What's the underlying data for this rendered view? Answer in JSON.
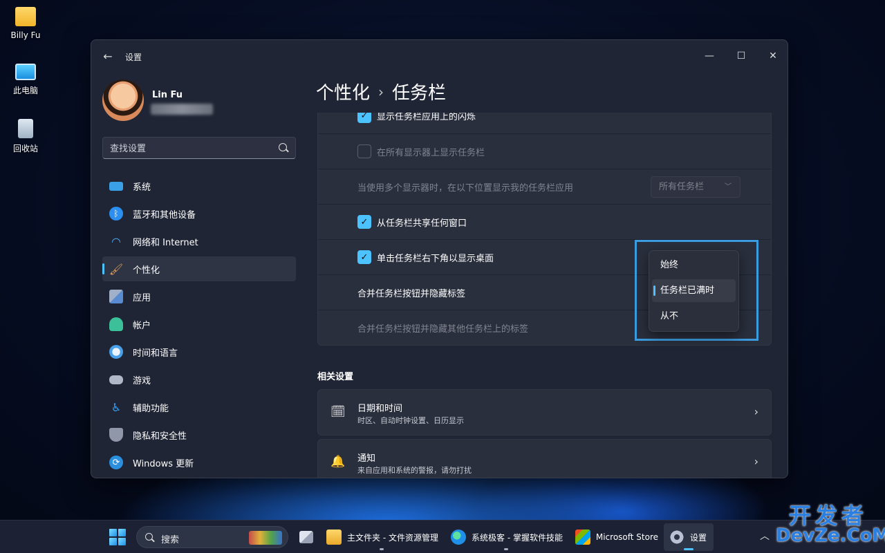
{
  "desktop": {
    "icons": [
      {
        "label": "Billy Fu",
        "icon": "folder-icon"
      },
      {
        "label": "此电脑",
        "icon": "this-pc-icon"
      },
      {
        "label": "回收站",
        "icon": "recycle-bin-icon"
      }
    ]
  },
  "window": {
    "title": "设置",
    "controls": {
      "minimize": "—",
      "maximize": "☐",
      "close": "✕"
    }
  },
  "profile": {
    "name": "Lin Fu"
  },
  "search": {
    "placeholder": "查找设置"
  },
  "sidebar": {
    "items": [
      {
        "label": "系统",
        "icon": "system-icon",
        "color": "#3aa0e8"
      },
      {
        "label": "蓝牙和其他设备",
        "icon": "bluetooth-icon",
        "color": "#2b8ff0"
      },
      {
        "label": "网络和 Internet",
        "icon": "wifi-icon",
        "color": "#4aa8f0"
      },
      {
        "label": "个性化",
        "icon": "brush-icon",
        "color": "#e0a060",
        "active": true
      },
      {
        "label": "应用",
        "icon": "apps-icon",
        "color": "#8fa0b8"
      },
      {
        "label": "帐户",
        "icon": "account-icon",
        "color": "#3cc09a"
      },
      {
        "label": "时间和语言",
        "icon": "time-language-icon",
        "color": "#4aa0e8"
      },
      {
        "label": "游戏",
        "icon": "gaming-icon",
        "color": "#b0b8c8"
      },
      {
        "label": "辅助功能",
        "icon": "accessibility-icon",
        "color": "#3aa0f0"
      },
      {
        "label": "隐私和安全性",
        "icon": "shield-icon",
        "color": "#8f97a8"
      },
      {
        "label": "Windows 更新",
        "icon": "update-icon",
        "color": "#2b8fe0"
      }
    ]
  },
  "breadcrumb": {
    "parent": "个性化",
    "separator": "›",
    "current": "任务栏"
  },
  "taskbar_behaviors": {
    "rows": [
      {
        "label": "显示任务栏应用上的闪烁",
        "type": "checkbox",
        "checked": true,
        "enabled": true
      },
      {
        "label": "在所有显示器上显示任务栏",
        "type": "checkbox",
        "checked": false,
        "enabled": false
      },
      {
        "label": "当使用多个显示器时，在以下位置显示我的任务栏应用",
        "type": "combo",
        "value": "所有任务栏",
        "enabled": false
      },
      {
        "label": "从任务栏共享任何窗口",
        "type": "checkbox",
        "checked": true,
        "enabled": true
      },
      {
        "label": "单击任务栏右下角以显示桌面",
        "type": "checkbox",
        "checked": true,
        "enabled": true
      },
      {
        "label": "合并任务栏按钮并隐藏标签",
        "type": "dropdown",
        "enabled": true
      },
      {
        "label": "合并任务栏按钮并隐藏其他任务栏上的标签",
        "type": "dropdown",
        "enabled": false
      }
    ]
  },
  "dropdown_popup": {
    "options": [
      "始终",
      "任务栏已满时",
      "从不"
    ],
    "selected": "任务栏已满时"
  },
  "related": {
    "title": "相关设置",
    "items": [
      {
        "title": "日期和时间",
        "subtitle": "时区、自动时钟设置、日历显示",
        "icon": "calendar-clock-icon"
      },
      {
        "title": "通知",
        "subtitle": "来自应用和系统的警报，请勿打扰",
        "icon": "bell-icon"
      }
    ]
  },
  "taskbar": {
    "search_label": "搜索",
    "apps": [
      {
        "label": "",
        "icon": "task-view-icon"
      },
      {
        "label": "主文件夹 - 文件资源管理",
        "icon": "file-explorer-icon"
      },
      {
        "label": "系统极客 - 掌握软件技能",
        "icon": "edge-icon"
      },
      {
        "label": "Microsoft Store",
        "icon": "store-icon"
      },
      {
        "label": "设置",
        "icon": "settings-gear-icon",
        "active": true
      }
    ],
    "tray_chevron": "︿"
  },
  "watermark": {
    "line1": "开发者",
    "line2": "DevZe.CoM"
  },
  "colors": {
    "accent": "#4cc2ff",
    "highlight_frame": "#3b9ce0",
    "window_bg": "#202535",
    "card_bg": "#2a2f3d"
  }
}
